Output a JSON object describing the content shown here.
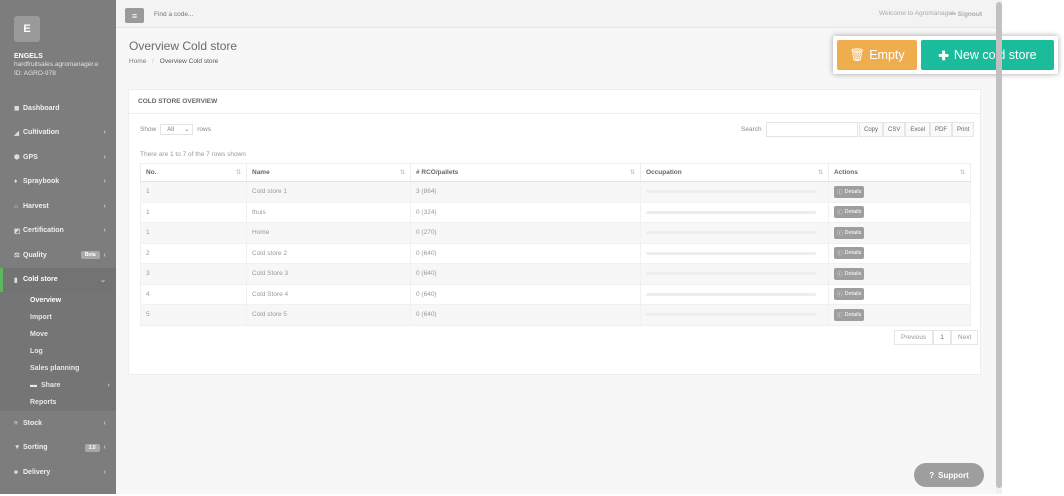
{
  "sidebar": {
    "logo": "E",
    "user_name": "ENGELS",
    "user_email": "hardfruitsales.agromanager.e",
    "user_id": "ID: AGRO-978",
    "items": [
      {
        "label": "Dashboard",
        "icon": "dashboard-icon",
        "glyph": "◼"
      },
      {
        "label": "Cultivation",
        "icon": "leaf-icon",
        "glyph": "◢"
      },
      {
        "label": "GPS",
        "icon": "map-marker-icon",
        "glyph": "⬢"
      },
      {
        "label": "Spraybook",
        "icon": "spray-icon",
        "glyph": "♦"
      },
      {
        "label": "Harvest",
        "icon": "basket-icon",
        "glyph": "⌂"
      },
      {
        "label": "Certification",
        "icon": "certificate-icon",
        "glyph": "◩"
      },
      {
        "label": "Quality",
        "icon": "scale-icon",
        "glyph": "⚖",
        "badge": "Beta"
      },
      {
        "label": "Cold store",
        "icon": "thermometer-icon",
        "glyph": "▮"
      }
    ],
    "sub_items": [
      {
        "label": "Overview"
      },
      {
        "label": "Import"
      },
      {
        "label": "Move"
      },
      {
        "label": "Log"
      },
      {
        "label": "Sales planning"
      },
      {
        "label": "Share",
        "icon": "folder-icon",
        "glyph": "▬"
      },
      {
        "label": "Reports"
      }
    ],
    "bottom_items": [
      {
        "label": "Stock",
        "icon": "list-icon",
        "glyph": "≡"
      },
      {
        "label": "Sorting",
        "icon": "filter-icon",
        "glyph": "▼",
        "badge": "2.0"
      },
      {
        "label": "Delivery",
        "icon": "truck-icon",
        "glyph": "■"
      }
    ]
  },
  "topbar": {
    "search_placeholder": "Find a code...",
    "welcome": "Welcome to Agromanager",
    "signout": "Signout"
  },
  "page": {
    "title": "Overview Cold store",
    "breadcrumb_home": "Home",
    "breadcrumb_current": "Overview Cold store"
  },
  "actions": {
    "empty_label": "Empty",
    "new_label": "New cold store"
  },
  "panel": {
    "title": "COLD STORE OVERVIEW",
    "show_label": "Show",
    "show_value": "All",
    "rows_label": "rows",
    "search_label": "Search",
    "exports": [
      "Copy",
      "CSV",
      "Excel",
      "PDF",
      "Print"
    ],
    "info": "There are 1 to 7 of the 7 rows shown"
  },
  "table": {
    "headers": [
      "No.",
      "Name",
      "# RCO/pallets",
      "Occupation",
      "Actions"
    ],
    "details_label": "Details",
    "rows": [
      {
        "no": "1",
        "name": "Cold store 1",
        "rco": "3 (864)"
      },
      {
        "no": "1",
        "name": "thuis",
        "rco": "0 (324)"
      },
      {
        "no": "1",
        "name": "Home",
        "rco": "0 (270)"
      },
      {
        "no": "2",
        "name": "Cold store 2",
        "rco": "0 (640)"
      },
      {
        "no": "3",
        "name": "Cold Store 3",
        "rco": "0 (640)"
      },
      {
        "no": "4",
        "name": "Cold Store 4",
        "rco": "0 (640)"
      },
      {
        "no": "5",
        "name": "Cold store 5",
        "rco": "0 (640)"
      }
    ]
  },
  "pagination": {
    "previous": "Previous",
    "page": "1",
    "next": "Next"
  },
  "support": {
    "label": "Support"
  },
  "colors": {
    "sidebar": "#7d7d7d",
    "empty_button": "#f0ad4e",
    "new_button": "#1abc9c",
    "active_marker": "#5cb85c"
  }
}
